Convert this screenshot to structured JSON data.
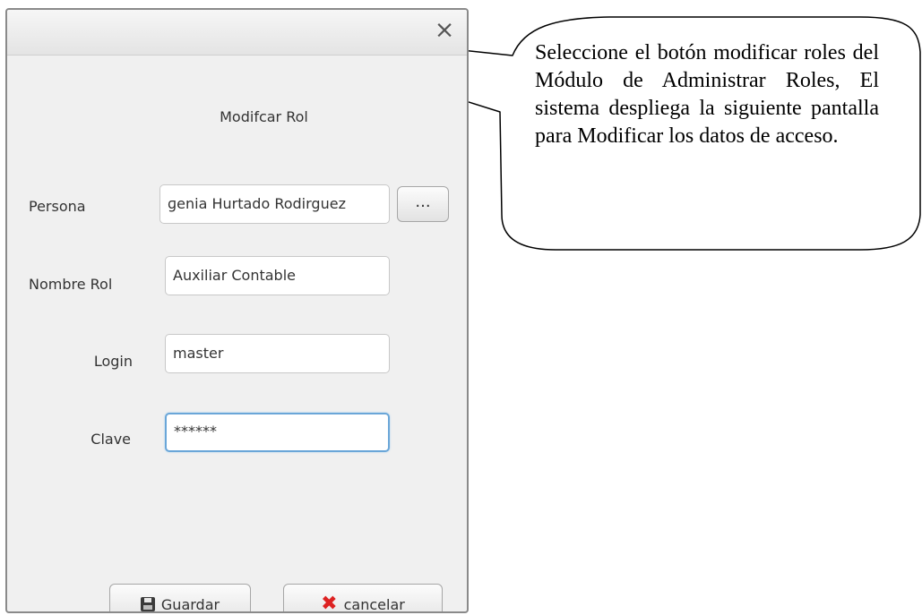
{
  "dialog": {
    "close_glyph": "×",
    "title": "Modifcar Rol",
    "fields": {
      "persona": {
        "label": "Persona",
        "value": "ɡenia Hurtado Rodirguez"
      },
      "nombre_rol": {
        "label": "Nombre Rol",
        "value": "Auxiliar Contable"
      },
      "login": {
        "label": "Login",
        "value": "master"
      },
      "clave": {
        "label": "Clave",
        "value": "******"
      }
    },
    "browse_label": "...",
    "buttons": {
      "guardar": {
        "label": "Guardar",
        "icon": "floppy-disk-icon"
      },
      "cancelar": {
        "label": "cancelar",
        "icon": "red-x-icon"
      }
    }
  },
  "callout": {
    "text": "Seleccione el botón modificar roles del Módulo de Administrar Roles, El sistema despliega la siguiente pantalla para Modificar los datos de acceso."
  }
}
